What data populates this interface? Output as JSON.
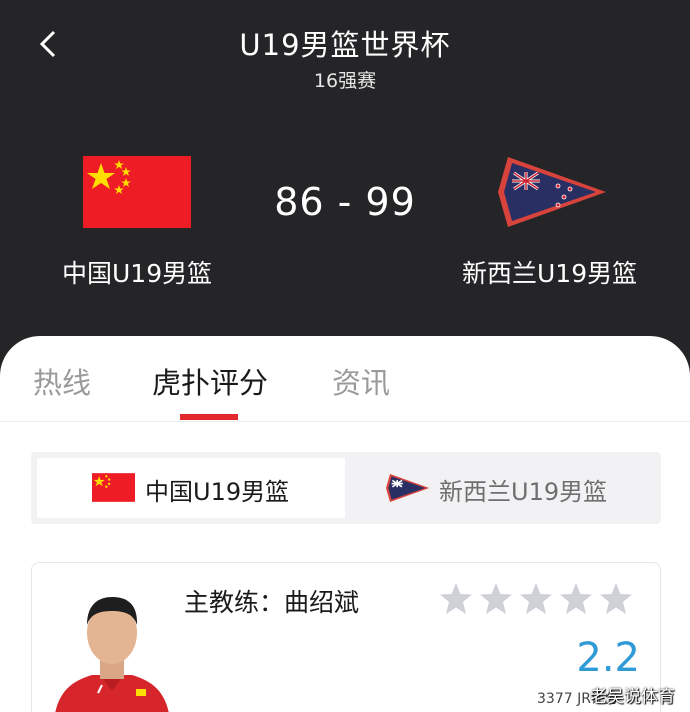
{
  "header": {
    "title": "U19男篮世界杯",
    "subtitle": "16强赛",
    "score": "86 - 99",
    "home_team": "中国U19男篮",
    "away_team": "新西兰U19男篮"
  },
  "tabs": [
    {
      "label": "热线"
    },
    {
      "label": "虎扑评分"
    },
    {
      "label": "资讯"
    }
  ],
  "team_switch": {
    "home_label": "中国U19男篮",
    "away_label": "新西兰U19男篮"
  },
  "rating_card": {
    "coach_label": "主教练：曲绍斌",
    "stars_filled": 0,
    "stars_total": 5,
    "rating": "2.2"
  },
  "footer": {
    "count_text": "3377 JR评分",
    "watermark": "老吴说体育"
  },
  "colors": {
    "header_bg": "#252528",
    "accent_red": "#e2272d",
    "rating_blue": "#2e9ad6",
    "star_gray": "#cfd1d6"
  },
  "icons": {
    "back": "chevron-left-icon",
    "star": "star-icon"
  }
}
